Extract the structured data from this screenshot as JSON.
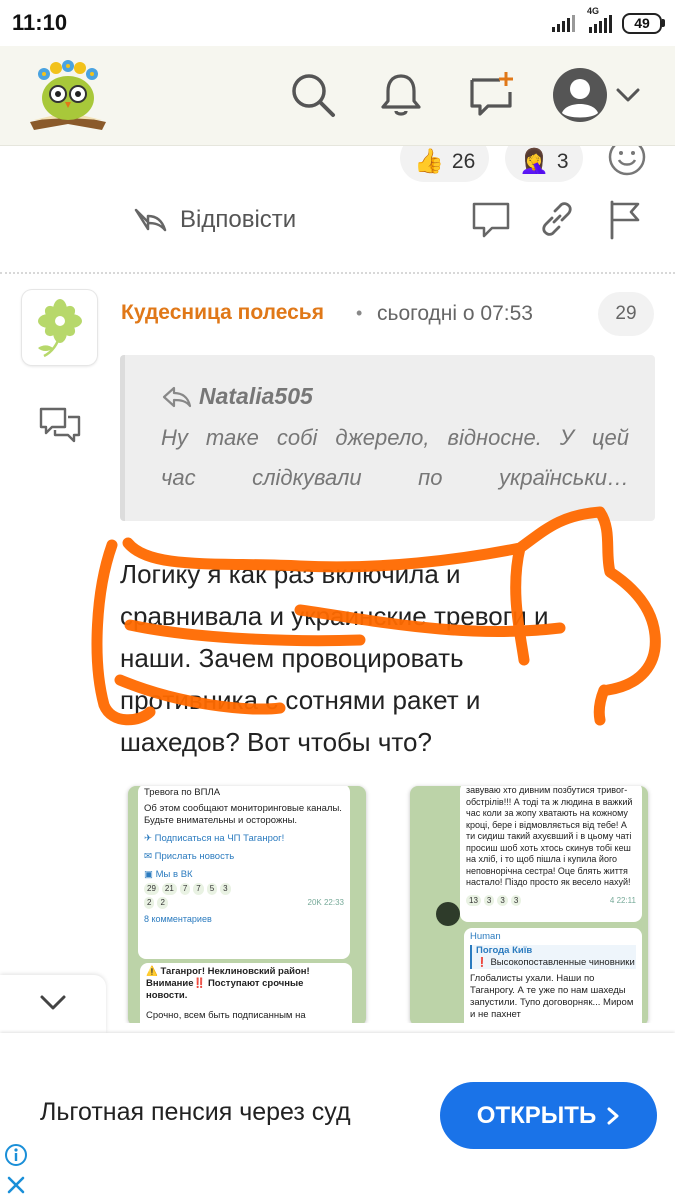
{
  "status_bar": {
    "time": "11:10",
    "network": "4G",
    "battery": "49"
  },
  "app_bar": {
    "logo": "owl-reading-book-logo",
    "icons": [
      "search-icon",
      "bell-icon",
      "new-message-icon",
      "user-avatar-icon",
      "chevron-down-icon"
    ]
  },
  "reactions": [
    {
      "emoji": "👍",
      "count": "26"
    },
    {
      "emoji": "🤦‍♀️",
      "count": "3"
    }
  ],
  "actions": {
    "reply_label": "Відповісти"
  },
  "post": {
    "author": "Кудесница полесья",
    "separator": "•",
    "time": "сьогодні о 07:53",
    "number": "29",
    "quote": {
      "author": "Natalia505",
      "line1": "Ну таке собі джерело, відносне. У цей",
      "line2": "час слідкували по українськи…"
    },
    "text_lines": [
      "Логику я как раз включила и",
      "сравнивала и украинские тревоги и",
      "наши. Зачем провоцировать",
      "противника с сотнями ракет и",
      "шахедов? Вот чтобы что?"
    ]
  },
  "screenshot1": {
    "top": "Тревога по ВПЛА",
    "msg1": "Об этом сообщают мониторинговые каналы. Будьте внимательны и осторожны.",
    "link1": "Подписаться на ЧП Таганрог!",
    "link2": "Прислать новость",
    "link3": "Мы в ВК",
    "r1": "29",
    "r2": "21",
    "r3": "7",
    "r4": "7",
    "r5": "5",
    "r6": "3",
    "r7": "2",
    "r8": "2",
    "meta": "20K  22:33",
    "comments": "8 комментариев",
    "msg2": "⚠️ Таганрог! Неклиновский район! Внимание‼️ Поступают срочные новости.",
    "msg3": "Срочно, всем быть подписанным на"
  },
  "screenshot2": {
    "text": "завуваю хто дивним позбутися тривог-обстрілів!!! А тоді та ж людина в важкий час коли за жопу хватають на кожному кроці, бере і відмовляється від тебе! А ти сидиш такий ахуєвший і в цьому чаті просиш шоб хоть хтось скинув тобі кеш на хліб, і то щоб пішла і купила його неповнорічна сестра! Оце блять життя настало! Піздо просто як весело нахуй!",
    "r1": "13",
    "r2": "3",
    "r3": "3",
    "r4": "3",
    "meta": "4  22:11",
    "sender": "Human",
    "reply_channel": "Погода Київ",
    "reply_text": "❗ Высокопоставленные чиновники Тра...",
    "msg": "Глобалисты ухали. Наши по Таганрогу. А те уже по нам шахеды запустили. Тупо договорняк... Миром и не пахнет"
  },
  "ad": {
    "text": "Льготная пенсия через суд",
    "button": "ОТКРЫТЬ"
  },
  "colors": {
    "author": "#e07818",
    "ad_button": "#1a73e8",
    "scribble": "#ff6a00",
    "app_bar": "#f6f6ef"
  }
}
